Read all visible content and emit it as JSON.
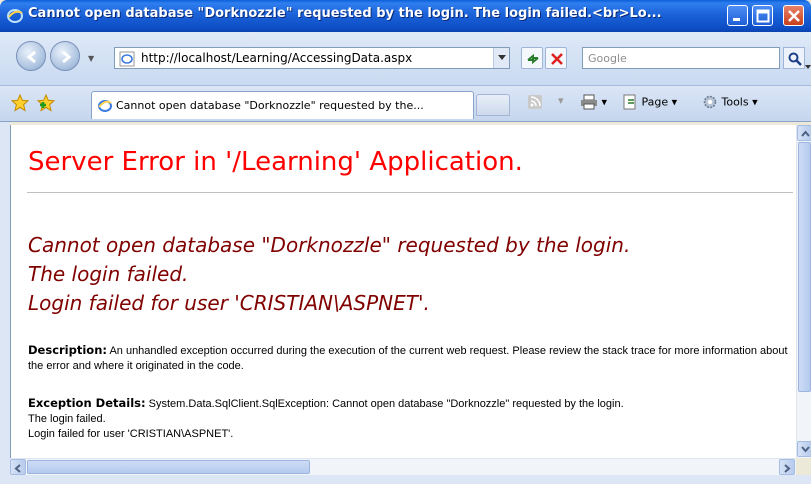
{
  "window": {
    "title": "Cannot open database \"Dorknozzle\" requested by the login. The login failed.<br>Lo...",
    "controls": [
      "minimize",
      "maximize",
      "close"
    ]
  },
  "toolbar": {
    "address": "http://localhost/Learning/AccessingData.aspx",
    "search_placeholder": "Google",
    "icons": [
      "back-icon",
      "forward-icon",
      "refresh-icon",
      "stop-icon",
      "search-icon"
    ]
  },
  "tabbar": {
    "active_tab": "Cannot open database \"Dorknozzle\" requested by the...",
    "commands": {
      "page": "Page",
      "tools": "Tools"
    }
  },
  "page": {
    "heading": "Server Error in '/Learning' Application.",
    "error_lines": [
      "Cannot open database \"Dorknozzle\" requested by the login.",
      "The login failed.",
      "Login failed for user 'CRISTIAN\\ASPNET'."
    ],
    "description_label": "Description:",
    "description_text": "An unhandled exception occurred during the execution of the current web request. Please review the stack trace for more information about the error and where it originated in the code.",
    "exception_label": "Exception Details:",
    "exception_text": "System.Data.SqlClient.SqlException: Cannot open database \"Dorknozzle\" requested by the login.",
    "exception_line2": "The login failed.",
    "exception_line3": "Login failed for user 'CRISTIAN\\ASPNET'."
  },
  "colors": {
    "heading": "#ff0000",
    "error_title": "#800000",
    "titlebar": "#0e4fc8"
  }
}
